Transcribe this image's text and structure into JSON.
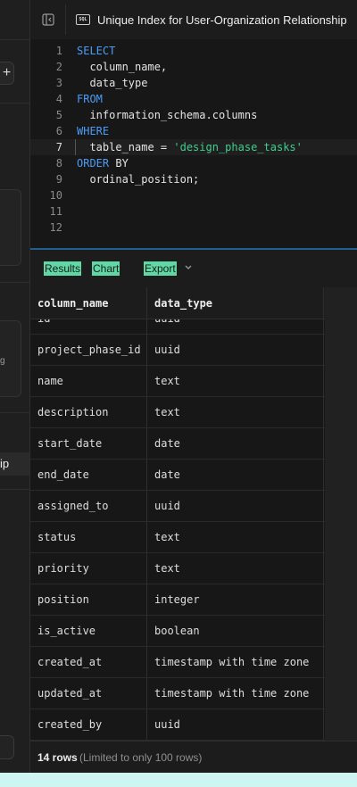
{
  "sidebar": {
    "add_icon": "plus-icon",
    "active_item_fragment": "ip",
    "tiny_text": "g"
  },
  "editor": {
    "title": "Unique Index for User-Organization Relationship",
    "lang_badge": "SQL",
    "active_line": 7,
    "lines": [
      {
        "n": "1",
        "tokens": [
          {
            "t": "SELECT",
            "k": "kw"
          }
        ]
      },
      {
        "n": "2",
        "tokens": [
          {
            "t": "  column_name,",
            "k": ""
          }
        ]
      },
      {
        "n": "3",
        "tokens": [
          {
            "t": "  data_type",
            "k": ""
          }
        ]
      },
      {
        "n": "4",
        "tokens": [
          {
            "t": "FROM",
            "k": "kw"
          }
        ]
      },
      {
        "n": "5",
        "tokens": [
          {
            "t": "  information_schema.columns",
            "k": ""
          }
        ]
      },
      {
        "n": "6",
        "tokens": [
          {
            "t": "WHERE",
            "k": "kw"
          }
        ]
      },
      {
        "n": "7",
        "tokens": [
          {
            "t": "  table_name = ",
            "k": ""
          },
          {
            "t": "'design_phase_tasks'",
            "k": "str"
          }
        ]
      },
      {
        "n": "8",
        "tokens": [
          {
            "t": "ORDER",
            "k": "kw"
          },
          {
            "t": " BY",
            "k": ""
          }
        ]
      },
      {
        "n": "9",
        "tokens": [
          {
            "t": "  ordinal_position;",
            "k": ""
          }
        ]
      },
      {
        "n": "10",
        "tokens": []
      },
      {
        "n": "11",
        "tokens": []
      },
      {
        "n": "12",
        "tokens": []
      }
    ]
  },
  "results": {
    "tabs": [
      {
        "label": "Results",
        "name": "tab-results"
      },
      {
        "label": "Chart",
        "name": "tab-chart"
      },
      {
        "label": "Export",
        "name": "tab-export"
      }
    ],
    "columns": [
      "column_name",
      "data_type"
    ],
    "rows": [
      [
        "id",
        "uuid"
      ],
      [
        "project_phase_id",
        "uuid"
      ],
      [
        "name",
        "text"
      ],
      [
        "description",
        "text"
      ],
      [
        "start_date",
        "date"
      ],
      [
        "end_date",
        "date"
      ],
      [
        "assigned_to",
        "uuid"
      ],
      [
        "status",
        "text"
      ],
      [
        "priority",
        "text"
      ],
      [
        "position",
        "integer"
      ],
      [
        "is_active",
        "boolean"
      ],
      [
        "created_at",
        "timestamp with time zone"
      ],
      [
        "updated_at",
        "timestamp with time zone"
      ],
      [
        "created_by",
        "uuid"
      ]
    ],
    "row_count": "14 rows",
    "limit_note": "(Limited to only 100 rows)"
  },
  "colors": {
    "keyword": "#4b9cf5",
    "string": "#3ecf8e",
    "tab_highlight": "#5fd8a5",
    "divider": "#1f5f94"
  }
}
